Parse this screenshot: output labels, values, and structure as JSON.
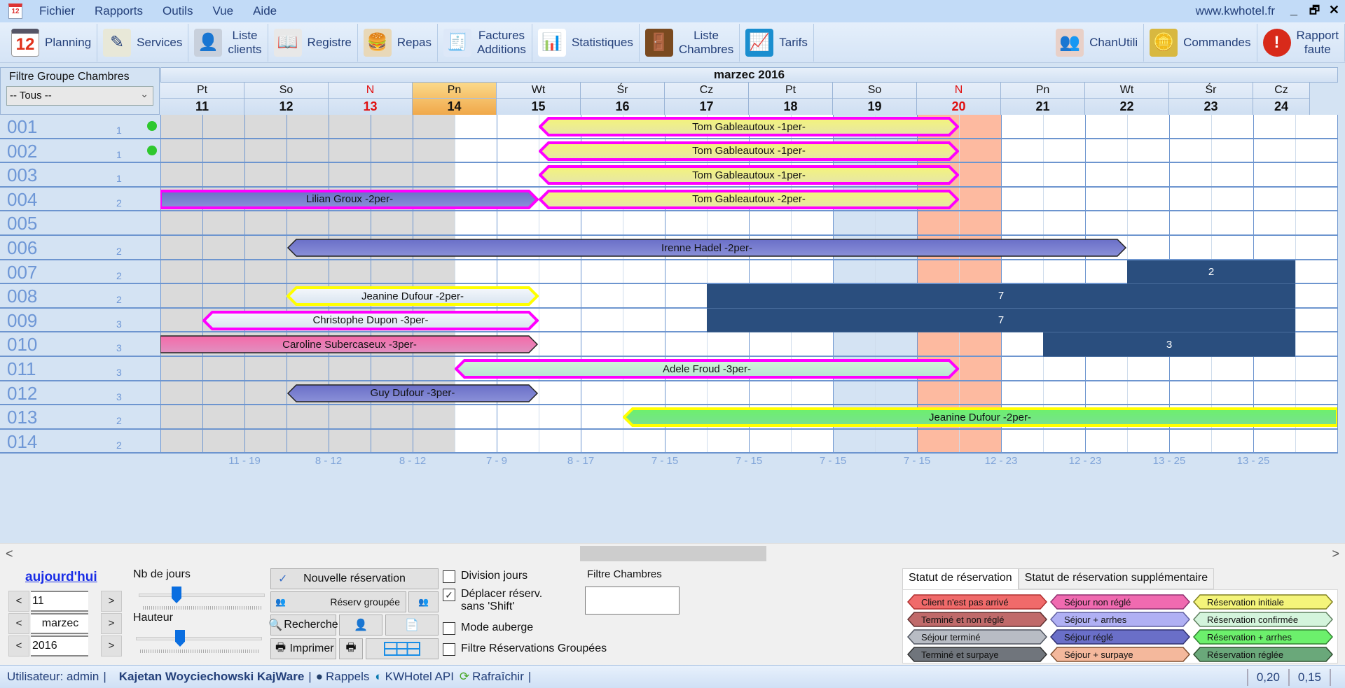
{
  "menubar": {
    "items": [
      "Fichier",
      "Rapports",
      "Outils",
      "Vue",
      "Aide"
    ],
    "site": "www.kwhotel.fr",
    "app_icon_text": "12",
    "window_buttons": {
      "minimize": "_",
      "restore": "🗗",
      "close": "✕"
    }
  },
  "toolbar": {
    "left": [
      {
        "label": "Planning",
        "icon": "calendar-icon",
        "glyph": "12"
      },
      {
        "label": "Services",
        "icon": "chart-pencil-icon",
        "glyph": "✎"
      },
      {
        "label": "Liste\nclients",
        "icon": "person-icon",
        "glyph": "👤"
      },
      {
        "label": "Registre",
        "icon": "open-book-icon",
        "glyph": "📖"
      },
      {
        "label": "Repas",
        "icon": "meal-icon",
        "glyph": "🍔"
      },
      {
        "label": "Factures\nAdditions",
        "icon": "invoice-icon",
        "glyph": "🧾"
      },
      {
        "label": "Statistiques",
        "icon": "statistics-icon",
        "glyph": "📊"
      },
      {
        "label": "Liste\nChambres",
        "icon": "door-icon",
        "glyph": "🚪"
      },
      {
        "label": "Tarifs",
        "icon": "tariff-chart-icon",
        "glyph": "📈"
      }
    ],
    "right": [
      {
        "label": "ChanUtili",
        "icon": "users-group-icon",
        "glyph": "👥"
      },
      {
        "label": "Commandes",
        "icon": "coins-icon",
        "glyph": "🪙"
      },
      {
        "label": "Rapport\nfaute",
        "icon": "error-report-icon",
        "glyph": "!"
      }
    ]
  },
  "filter": {
    "title": "Filtre Groupe Chambres",
    "selected": "-- Tous --"
  },
  "calendar": {
    "month_label": "marzec  2016",
    "days": [
      {
        "name": "Pt",
        "date": "11",
        "sunday": false,
        "today": false
      },
      {
        "name": "So",
        "date": "12",
        "sunday": false,
        "today": false
      },
      {
        "name": "N",
        "date": "13",
        "sunday": true,
        "today": false
      },
      {
        "name": "Pn",
        "date": "14",
        "sunday": false,
        "today": true
      },
      {
        "name": "Wt",
        "date": "15",
        "sunday": false,
        "today": false
      },
      {
        "name": "Śr",
        "date": "16",
        "sunday": false,
        "today": false
      },
      {
        "name": "Cz",
        "date": "17",
        "sunday": false,
        "today": false
      },
      {
        "name": "Pt",
        "date": "18",
        "sunday": false,
        "today": false
      },
      {
        "name": "So",
        "date": "19",
        "sunday": false,
        "today": false
      },
      {
        "name": "N",
        "date": "20",
        "sunday": true,
        "today": false
      },
      {
        "name": "Pn",
        "date": "21",
        "sunday": false,
        "today": false
      },
      {
        "name": "Wt",
        "date": "22",
        "sunday": false,
        "today": false
      },
      {
        "name": "Śr",
        "date": "23",
        "sunday": false,
        "today": false
      },
      {
        "name": "Cz",
        "date": "24",
        "sunday": false,
        "today": false
      }
    ],
    "prices": [
      "11 - 19",
      "8 - 12",
      "8 - 12",
      "7 - 9",
      "8 - 17",
      "7 - 15",
      "7 - 15",
      "7 - 15",
      "7 - 15",
      "12 - 23",
      "12 - 23",
      "13 - 25",
      "13 - 25",
      ""
    ],
    "past_days": 3.5,
    "weekend_cols": [
      8
    ],
    "holiday_cols": [
      9
    ]
  },
  "rooms": [
    {
      "num": "001",
      "cap": "1",
      "available": true
    },
    {
      "num": "002",
      "cap": "1",
      "available": true
    },
    {
      "num": "003",
      "cap": "1",
      "available": false
    },
    {
      "num": "004",
      "cap": "2",
      "available": false
    },
    {
      "num": "005",
      "cap": "",
      "available": false
    },
    {
      "num": "006",
      "cap": "2",
      "available": false
    },
    {
      "num": "007",
      "cap": "2",
      "available": false
    },
    {
      "num": "008",
      "cap": "2",
      "available": false
    },
    {
      "num": "009",
      "cap": "3",
      "available": false
    },
    {
      "num": "010",
      "cap": "3",
      "available": false
    },
    {
      "num": "011",
      "cap": "3",
      "available": false
    },
    {
      "num": "012",
      "cap": "3",
      "available": false
    },
    {
      "num": "013",
      "cap": "2",
      "available": false
    },
    {
      "num": "014",
      "cap": "2",
      "available": false
    }
  ],
  "reservations": [
    {
      "room": 0,
      "start": 4.5,
      "end": 9.5,
      "label": "Tom Gableautoux -1per-",
      "fill": "#f4f47a",
      "border": "#ff00ff",
      "fill2": "#e6e6a8"
    },
    {
      "room": 1,
      "start": 4.5,
      "end": 9.5,
      "label": "Tom Gableautoux -1per-",
      "fill": "#f4f47a",
      "border": "#ff00ff",
      "fill2": "#e6e6a8"
    },
    {
      "room": 2,
      "start": 4.5,
      "end": 9.5,
      "label": "Tom Gableautoux -1per-",
      "fill": "#f4f47a",
      "border": "#ff00ff",
      "fill2": "#e6e6a8"
    },
    {
      "room": 3,
      "start": 0,
      "end": 4.5,
      "label": "Lilian Groux -2per-",
      "fill": "#6a6fc8",
      "border": "#ff00ff",
      "fill2": "#8a90d8",
      "open_left": true
    },
    {
      "room": 3,
      "start": 4.5,
      "end": 9.5,
      "label": "Tom Gableautoux -2per-",
      "fill": "#f4f47a",
      "border": "#ff00ff",
      "fill2": "#e6e6a8"
    },
    {
      "room": 5,
      "start": 1.5,
      "end": 11.5,
      "label": "Irenne Hadel -2per-",
      "fill": "#6a6fc8",
      "border": "#222",
      "fill2": "#8a90d8"
    },
    {
      "room": 7,
      "start": 1.5,
      "end": 4.5,
      "label": "Jeanine Dufour -2per-",
      "fill": "#f5f8fc",
      "border": "#ffff00",
      "fill2": "#d8e4f0"
    },
    {
      "room": 8,
      "start": 0.5,
      "end": 4.5,
      "label": "Christophe Dupon -3per-",
      "fill": "#f5f8fc",
      "border": "#ff00ff",
      "fill2": "#d8e4f0"
    },
    {
      "room": 9,
      "start": 0,
      "end": 4.5,
      "label": "Caroline Subercaseux -3per-",
      "fill": "#f56aa8",
      "border": "#222",
      "fill2": "#e090c0",
      "open_left": true
    },
    {
      "room": 10,
      "start": 3.5,
      "end": 9.5,
      "label": "Adele Froud -3per-",
      "fill": "#d2f6d8",
      "border": "#ff00ff",
      "fill2": "#b8e4d4"
    },
    {
      "room": 11,
      "start": 1.5,
      "end": 4.5,
      "label": "Guy Dufour -3per-",
      "fill": "#6a6fc8",
      "border": "#222",
      "fill2": "#8a90d8"
    },
    {
      "room": 12,
      "start": 5.5,
      "end": 14,
      "label": "Jeanine Dufour -2per-",
      "fill": "#6cf06c",
      "border": "#ffff00",
      "fill2": "#78e090",
      "open_right": true
    }
  ],
  "blocks": [
    {
      "room": 6,
      "rooms": 1,
      "start": 11.5,
      "end": 13.5,
      "label": "2"
    },
    {
      "room": 7,
      "rooms": 1,
      "start": 6.5,
      "end": 13.5,
      "label": "7"
    },
    {
      "room": 8,
      "rooms": 1,
      "start": 6.5,
      "end": 13.5,
      "label": "7"
    },
    {
      "room": 9,
      "rooms": 1,
      "start": 10.5,
      "end": 13.5,
      "label": "3"
    }
  ],
  "scroll": {
    "left": "<",
    "right": ">"
  },
  "controls": {
    "today_link": "aujourd'hui",
    "day_value": "11",
    "month_value": "marzec",
    "year_value": "2016",
    "prev": "<",
    "next": ">",
    "nb_jours_label": "Nb de jours",
    "nb_jours_fraction": 0.3,
    "hauteur_label": "Hauteur",
    "hauteur_fraction": 0.35,
    "new_reservation": "Nouvelle réservation",
    "group_reservation": "Réserv groupée",
    "search": "Recherche",
    "print": "Imprimer",
    "checkboxes": [
      {
        "label": "Division jours",
        "checked": false
      },
      {
        "label": "Déplacer réserv.\nsans 'Shift'",
        "checked": true
      },
      {
        "label": "Mode auberge",
        "checked": false
      },
      {
        "label": "Filtre Réservations Groupées",
        "checked": false
      }
    ],
    "filter_rooms_label": "Filtre Chambres",
    "filter_rooms_value": ""
  },
  "legend": {
    "tabs": [
      "Statut de réservation",
      "Statut de réservation supplémentaire"
    ],
    "items": [
      {
        "label": "Client n'est pas arrivé",
        "color": "#f06a6a",
        "border": "#b03030"
      },
      {
        "label": "Séjour non réglé",
        "color": "#f06ab0",
        "border": "#903070"
      },
      {
        "label": "Réservation initiale",
        "color": "#f4f47a",
        "border": "#808020"
      },
      {
        "label": "Terminé et non réglé",
        "color": "#c06a6a",
        "border": "#603030"
      },
      {
        "label": "Séjour + arrhes",
        "color": "#b0b0f4",
        "border": "#6060a0"
      },
      {
        "label": "Réservation confirmée",
        "color": "#d4f4dc",
        "border": "#608060"
      },
      {
        "label": "Séjour terminé",
        "color": "#b8bcc4",
        "border": "#505560"
      },
      {
        "label": "Séjour réglé",
        "color": "#6a6fc8",
        "border": "#303070"
      },
      {
        "label": "Réservation + arrhes",
        "color": "#6cf06c",
        "border": "#308030"
      },
      {
        "label": "Terminé et surpaye",
        "color": "#70757c",
        "border": "#303030"
      },
      {
        "label": "Séjour + surpaye",
        "color": "#f4b89c",
        "border": "#805030"
      },
      {
        "label": "Réservation réglée",
        "color": "#6aa87a",
        "border": "#305030"
      }
    ]
  },
  "status": {
    "user": "Utilisateur: admin",
    "company": "Kajetan Woyciechowski KajWare",
    "reminders": "Rappels",
    "api": "KWHotel API",
    "refresh": "Rafraîchir",
    "val1": "0,20",
    "val2": "0,15"
  }
}
